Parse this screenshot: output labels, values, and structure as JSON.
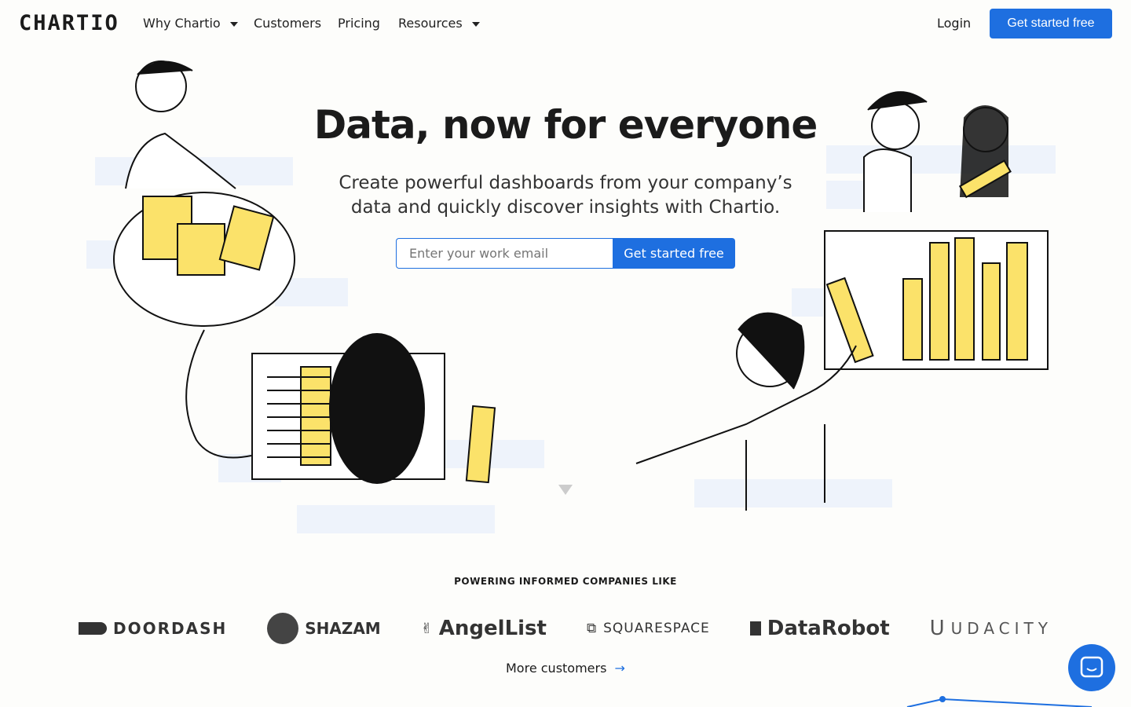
{
  "nav": {
    "logo": "CHARTIO",
    "items": [
      "Why Chartio",
      "Customers",
      "Pricing",
      "Resources"
    ],
    "login": "Login",
    "cta": "Get started free"
  },
  "hero": {
    "title": "Data, now for everyone",
    "subtitle": "Create powerful dashboards from your company’s data and quickly discover insights with Chartio.",
    "email_placeholder": "Enter your work email",
    "cta": "Get started free"
  },
  "customers": {
    "heading": "POWERING INFORMED COMPANIES LIKE",
    "logos": [
      "DOORDASH",
      "SHAZAM",
      "AngelList",
      "SQUARESPACE",
      "DataRobot",
      "UDACITY"
    ],
    "more": "More customers",
    "more_arrow": "→"
  },
  "colors": {
    "accent": "#1e6fe0",
    "yellow": "#fbe26a",
    "panel": "#eef3fb"
  }
}
